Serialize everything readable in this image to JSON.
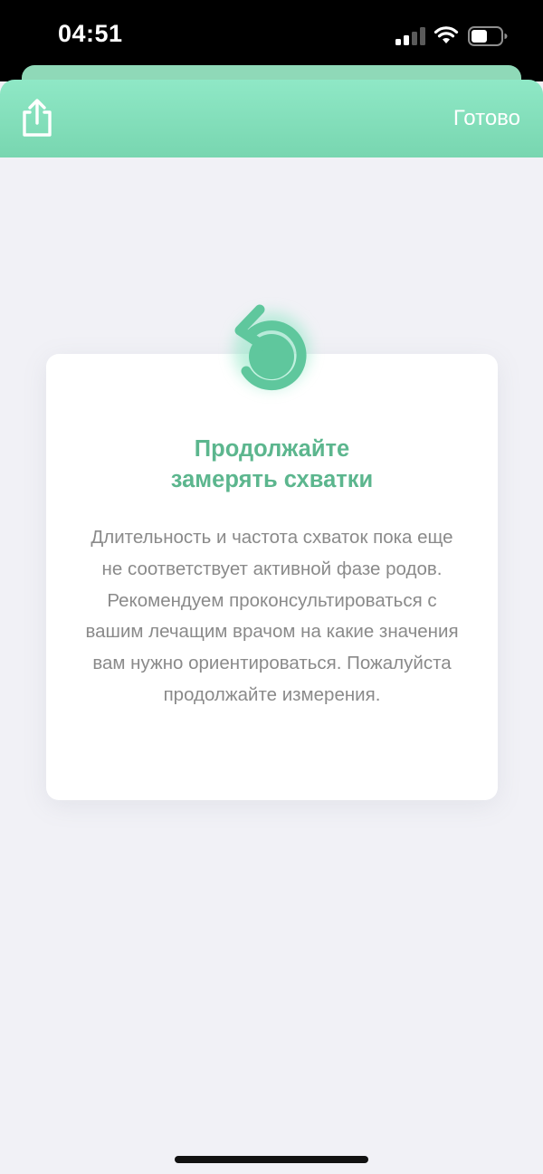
{
  "status_bar": {
    "time": "04:51",
    "signal_bars_active": 2,
    "signal_bars_total": 4,
    "battery_level": 0.5
  },
  "header": {
    "share_icon": "share-icon",
    "done_label": "Готово",
    "accent_color": "#80dcb8"
  },
  "card": {
    "icon": "restart-arrow-icon",
    "title": "Продолжайте\nзамерять схватки",
    "body": "Длительность и частота схваток пока еще не соответствует активной фазе родов. Рекомендуем проконсультироваться с вашим лечащим врачом на какие значения вам нужно ориентироваться. Пожалуйста продолжайте измерения.",
    "title_color": "#5cb68e"
  }
}
